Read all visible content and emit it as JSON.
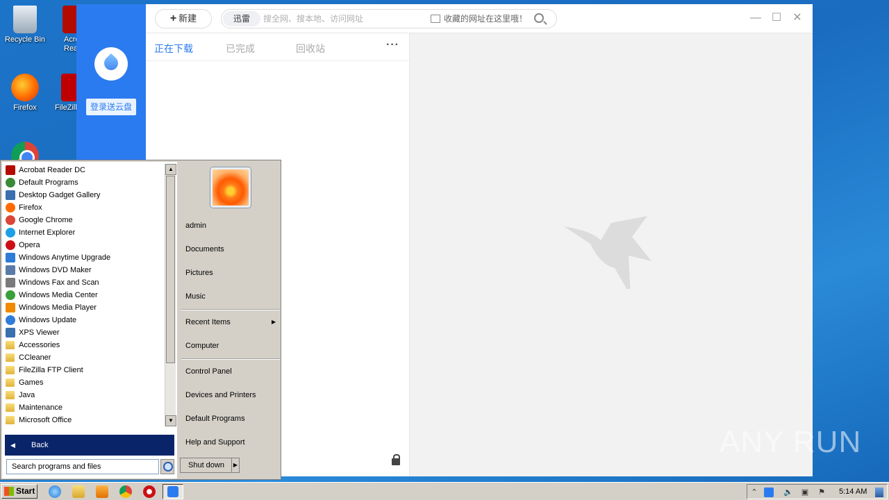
{
  "desktop": {
    "icons": [
      {
        "label": "Recycle Bin"
      },
      {
        "label": "Acro\nRead"
      },
      {
        "label": "Firefox"
      },
      {
        "label": "FileZilla"
      },
      {
        "label": ""
      }
    ]
  },
  "thunder": {
    "login_label": "登录送云盘",
    "new_label": "新建",
    "search": {
      "engine": "迅雷",
      "placeholder": "搜全网、搜本地、访问网址",
      "favorites_hint": "收藏的网址在这里哦！"
    },
    "window_controls": {
      "minimize": "—",
      "maximize": "☐",
      "close": "✕"
    },
    "tabs": [
      {
        "label": "正在下载",
        "active": true
      },
      {
        "label": "已完成",
        "active": false
      },
      {
        "label": "回收站",
        "active": false
      }
    ],
    "more_label": "···"
  },
  "start_menu": {
    "programs": [
      {
        "label": "Acrobat Reader DC",
        "icon": "acrobat-icon",
        "color": "#b30b00"
      },
      {
        "label": "Default Programs",
        "icon": "default-programs-icon",
        "color": "#3a8a3a"
      },
      {
        "label": "Desktop Gadget Gallery",
        "icon": "gadget-icon",
        "color": "#3a6fb0"
      },
      {
        "label": "Firefox",
        "icon": "firefox-icon",
        "color": "#ff6a00"
      },
      {
        "label": "Google Chrome",
        "icon": "chrome-icon",
        "color": "#db4437"
      },
      {
        "label": "Internet Explorer",
        "icon": "ie-icon",
        "color": "#1ea0e6"
      },
      {
        "label": "Opera",
        "icon": "opera-icon",
        "color": "#cc0f16"
      },
      {
        "label": "Windows Anytime Upgrade",
        "icon": "windows-icon",
        "color": "#2f7bd8"
      },
      {
        "label": "Windows DVD Maker",
        "icon": "dvd-icon",
        "color": "#5a7aa8"
      },
      {
        "label": "Windows Fax and Scan",
        "icon": "fax-icon",
        "color": "#7a7a7a"
      },
      {
        "label": "Windows Media Center",
        "icon": "media-center-icon",
        "color": "#3aa03a"
      },
      {
        "label": "Windows Media Player",
        "icon": "media-player-icon",
        "color": "#f08a00"
      },
      {
        "label": "Windows Update",
        "icon": "update-icon",
        "color": "#2f7bd8"
      },
      {
        "label": "XPS Viewer",
        "icon": "xps-icon",
        "color": "#3a6fb0"
      },
      {
        "label": "Accessories",
        "icon": "folder-icon",
        "color": "#e2b43c"
      },
      {
        "label": "CCleaner",
        "icon": "folder-icon",
        "color": "#e2b43c"
      },
      {
        "label": "FileZilla FTP Client",
        "icon": "folder-icon",
        "color": "#e2b43c"
      },
      {
        "label": "Games",
        "icon": "folder-icon",
        "color": "#e2b43c"
      },
      {
        "label": "Java",
        "icon": "folder-icon",
        "color": "#e2b43c"
      },
      {
        "label": "Maintenance",
        "icon": "folder-icon",
        "color": "#e2b43c"
      },
      {
        "label": "Microsoft Office",
        "icon": "folder-icon",
        "color": "#e2b43c"
      }
    ],
    "back_label": "Back",
    "search_placeholder": "Search programs and files",
    "right_items": {
      "user": "admin",
      "documents": "Documents",
      "pictures": "Pictures",
      "music": "Music",
      "recent": "Recent Items",
      "computer": "Computer",
      "control_panel": "Control Panel",
      "devices": "Devices and Printers",
      "default_programs": "Default Programs",
      "help": "Help and Support"
    },
    "shutdown_label": "Shut down"
  },
  "taskbar": {
    "start_label": "Start",
    "clock": "5:14 AM"
  },
  "watermark": "ANY RUN"
}
